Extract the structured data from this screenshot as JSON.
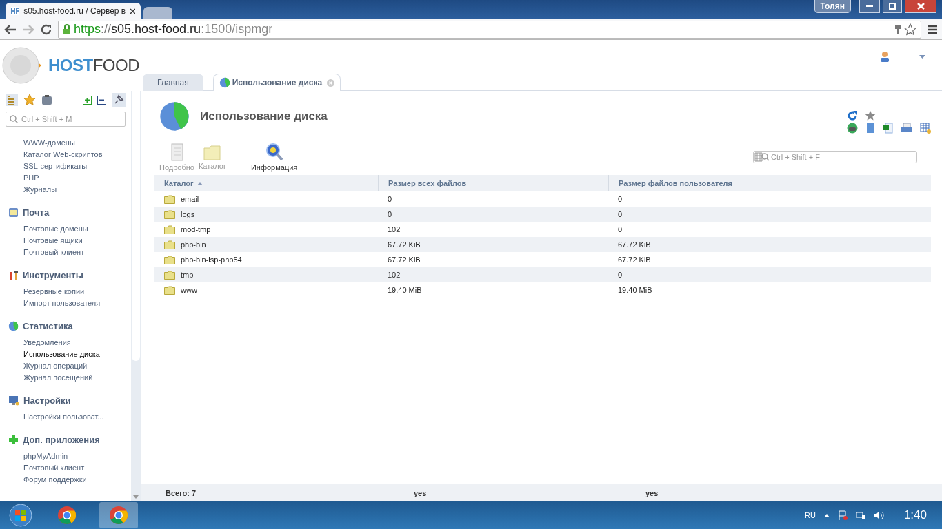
{
  "browser": {
    "tabs": [
      {
        "title": "s05.host-food.ru / Сервер в",
        "selected": true
      },
      {
        "selected": false
      }
    ],
    "profile": "Толян",
    "url": {
      "scheme": "https",
      "sep": "://",
      "host": "s05.host-food.ru",
      "rest": ":1500/ispmgr"
    }
  },
  "logo": {
    "first": "HOST",
    "second": "FOOD"
  },
  "page_tabs": [
    {
      "label": "Главная",
      "selected": false
    },
    {
      "label": "Использование диска",
      "selected": true
    }
  ],
  "sidebar": {
    "search": {
      "placeholder": "Ctrl + Shift + M"
    },
    "groups": [
      {
        "items": [
          {
            "label": "WWW-домены",
            "selected": false
          },
          {
            "label": "Каталог Web-скриптов",
            "selected": false
          },
          {
            "label": "SSL-сертификаты",
            "selected": false
          },
          {
            "label": "PHP",
            "selected": false
          },
          {
            "label": "Журналы",
            "selected": false
          }
        ]
      },
      {
        "kind": "mail",
        "title": "Почта",
        "items": [
          {
            "label": "Почтовые домены",
            "selected": false
          },
          {
            "label": "Почтовые ящики",
            "selected": false
          },
          {
            "label": "Почтовый клиент",
            "selected": false
          }
        ]
      },
      {
        "kind": "tools",
        "title": "Инструменты",
        "items": [
          {
            "label": "Резервные копии",
            "selected": false
          },
          {
            "label": "Импорт пользователя",
            "selected": false
          }
        ]
      },
      {
        "kind": "stats",
        "title": "Статистика",
        "items": [
          {
            "label": "Уведомления",
            "selected": false
          },
          {
            "label": "Использование диска",
            "selected": true
          },
          {
            "label": "Журнал операций",
            "selected": false
          },
          {
            "label": "Журнал посещений",
            "selected": false
          }
        ]
      },
      {
        "kind": "settings",
        "title": "Настройки",
        "items": [
          {
            "label": "Настройки пользоват...",
            "selected": false
          }
        ]
      },
      {
        "kind": "apps",
        "title": "Доп. приложения",
        "items": [
          {
            "label": "phpMyAdmin",
            "selected": false
          },
          {
            "label": "Почтовый клиент",
            "selected": false
          },
          {
            "label": "Форум поддержки",
            "selected": false
          }
        ]
      }
    ]
  },
  "main": {
    "title": "Использование диска",
    "toolbar": [
      {
        "kind": "details",
        "label": "Подробно",
        "disabled": true
      },
      {
        "kind": "folder",
        "label": "Каталог",
        "disabled": true
      },
      {
        "kind": "info",
        "label": "Информация",
        "disabled": false
      }
    ],
    "filter": {
      "placeholder": "Ctrl + Shift + F"
    },
    "table": {
      "columns": [
        {
          "label": "Каталог",
          "sorted": true
        },
        {
          "label": "Размер всех файлов",
          "sorted": false
        },
        {
          "label": "Размер файлов пользователя",
          "sorted": false
        }
      ],
      "rows": [
        [
          "email",
          "0",
          "0"
        ],
        [
          "logs",
          "0",
          "0"
        ],
        [
          "mod-tmp",
          "102",
          "0"
        ],
        [
          "php-bin",
          "67.72 KiB",
          "67.72 KiB"
        ],
        [
          "php-bin-isp-php54",
          "67.72 KiB",
          "67.72 KiB"
        ],
        [
          "tmp",
          "102",
          "0"
        ],
        [
          "www",
          "19.40 MiB",
          "19.40 MiB"
        ]
      ],
      "footer": [
        "Всего: 7",
        "yes",
        "yes"
      ]
    }
  },
  "taskbar": {
    "language": "RU",
    "clock": "1:40"
  }
}
